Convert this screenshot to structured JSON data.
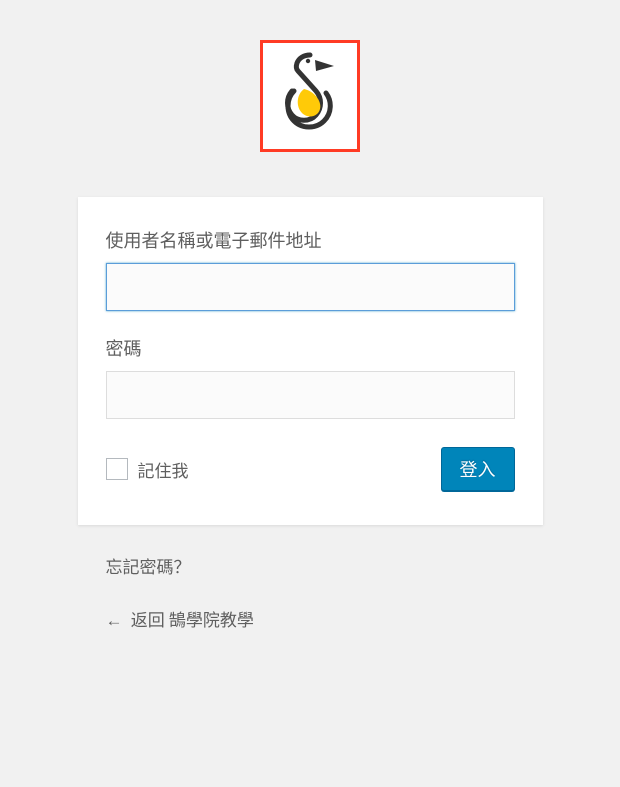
{
  "logo": {
    "name": "pelican-logo",
    "highlight_color": "#ff3b24",
    "accent_color": "#ffca08"
  },
  "form": {
    "username_label": "使用者名稱或電子郵件地址",
    "password_label": "密碼",
    "remember_label": "記住我",
    "submit_label": "登入"
  },
  "links": {
    "forgot_password": "忘記密碼？",
    "back_to_site": "返回 鵠學院教學",
    "back_arrow": "←"
  }
}
